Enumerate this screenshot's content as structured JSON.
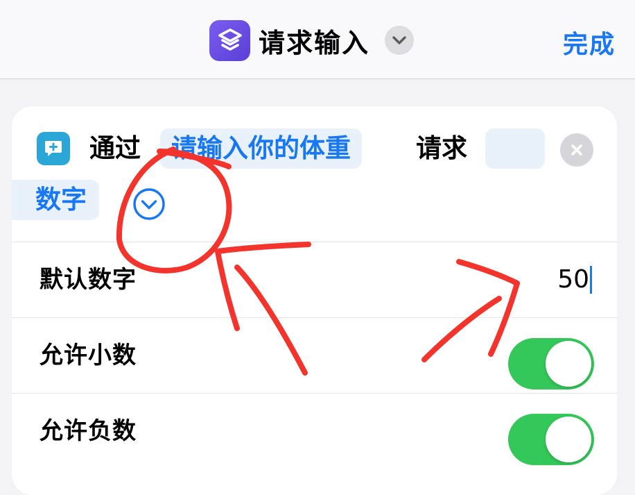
{
  "navbar": {
    "title": "请求输入",
    "done_label": "完成"
  },
  "action": {
    "prefix": "通过",
    "prompt_token": "请输入你的体重",
    "middle": "请求",
    "empty_token": "",
    "input_type_token": "数字"
  },
  "settings": {
    "default_number": {
      "label": "默认数字",
      "value": "50"
    },
    "allow_decimals": {
      "label": "允许小数",
      "enabled": true
    },
    "allow_negatives": {
      "label": "允许负数",
      "enabled": true
    }
  },
  "colors": {
    "accent": "#1877f2",
    "toggle_on": "#34c759",
    "annotation": "#f2342c",
    "shortcuts_icon": "#6a4ce6",
    "ask_icon": "#2aa7d6"
  },
  "icons": {
    "app": "shortcuts-icon",
    "title_menu": "chevron-down-icon",
    "action": "message-plus-icon",
    "clear": "close-icon",
    "expand": "chevron-down-circle-icon"
  }
}
